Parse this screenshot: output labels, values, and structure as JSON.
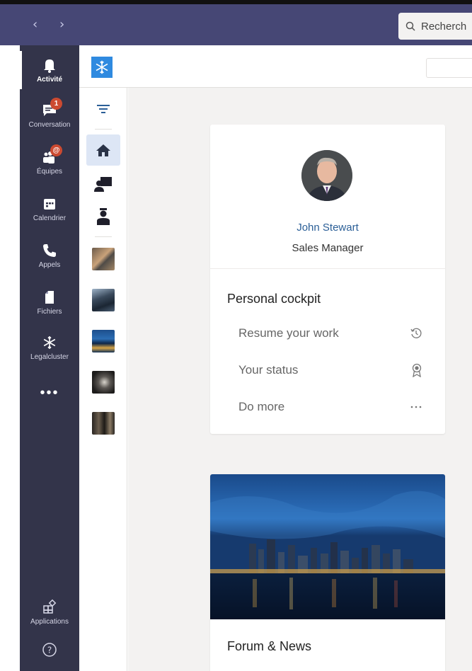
{
  "topbar": {
    "search_placeholder": "Recherch",
    "back_icon": "chevron-left-icon",
    "forward_icon": "chevron-right-icon"
  },
  "rail": {
    "items": [
      {
        "label": "Activité",
        "icon": "bell-icon",
        "active": true
      },
      {
        "label": "Conversation",
        "icon": "chat-icon",
        "badge": "1"
      },
      {
        "label": "Équipes",
        "icon": "teams-icon",
        "badge": "@"
      },
      {
        "label": "Calendrier",
        "icon": "calendar-icon"
      },
      {
        "label": "Appels",
        "icon": "phone-icon"
      },
      {
        "label": "Fichiers",
        "icon": "file-icon"
      },
      {
        "label": "Legalcluster",
        "icon": "snowflake-icon"
      }
    ],
    "more_label": "•••",
    "apps_label": "Applications",
    "help_icon": "help-icon"
  },
  "subnav": {
    "icons": [
      "filter-icon",
      "home-icon",
      "presenter-icon",
      "user-icon"
    ],
    "thumbnails": [
      "workspace-thumbnail",
      "buildings-thumbnail",
      "city-night-thumbnail",
      "compass-thumbnail",
      "skyscraper-thumbnail"
    ]
  },
  "profile": {
    "name": "John Stewart",
    "title": "Sales Manager"
  },
  "cockpit": {
    "title": "Personal cockpit",
    "items": [
      {
        "label": "Resume your work",
        "icon": "history-icon"
      },
      {
        "label": "Your status",
        "icon": "badge-ribbon-icon"
      },
      {
        "label": "Do more",
        "icon": "ellipsis-icon"
      }
    ]
  },
  "news": {
    "title": "Forum & News"
  },
  "colors": {
    "topbar": "#464775",
    "rail": "#33344a",
    "accent": "#2f8ae0",
    "badge": "#cc4a31",
    "link": "#2b5f97"
  }
}
